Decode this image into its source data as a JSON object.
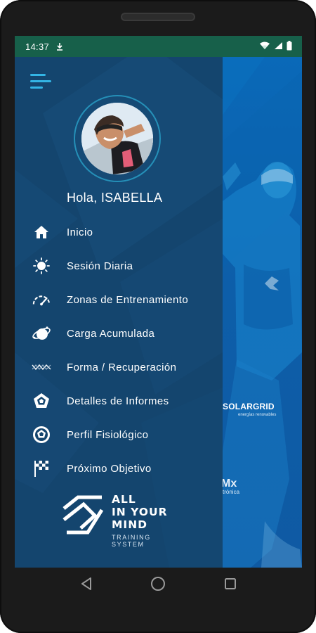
{
  "status_bar": {
    "time": "14:37"
  },
  "user": {
    "greeting": "Hola, ISABELLA"
  },
  "menu": [
    {
      "label": "Inicio",
      "icon": "home-icon"
    },
    {
      "label": "Sesión Diaria",
      "icon": "sun-icon"
    },
    {
      "label": "Zonas de Entrenamiento",
      "icon": "speedometer-icon"
    },
    {
      "label": "Carga Acumulada",
      "icon": "sphere-orbit-icon"
    },
    {
      "label": "Forma / Recuperación",
      "icon": "wave-icon"
    },
    {
      "label": "Detalles de Informes",
      "icon": "pentagon-icon"
    },
    {
      "label": "Perfil Fisiológico",
      "icon": "circle-pentagon-icon"
    },
    {
      "label": "Próximo Objetivo",
      "icon": "checkered-flag-icon"
    }
  ],
  "brand": {
    "title": "ALL\nIN YOUR\nMIND",
    "subtitle": "TRAINING\nSYSTEM"
  },
  "background": {
    "sponsor_1": "SOLARGRID",
    "sponsor_1_sub": "energías renovables",
    "sponsor_2": "Mx",
    "sponsor_2_sub": "trónica"
  },
  "colors": {
    "drawer": "#14456e",
    "status_bar": "#17604a",
    "accent": "#33b5e5",
    "promo_blue": "#0d5ea9"
  }
}
